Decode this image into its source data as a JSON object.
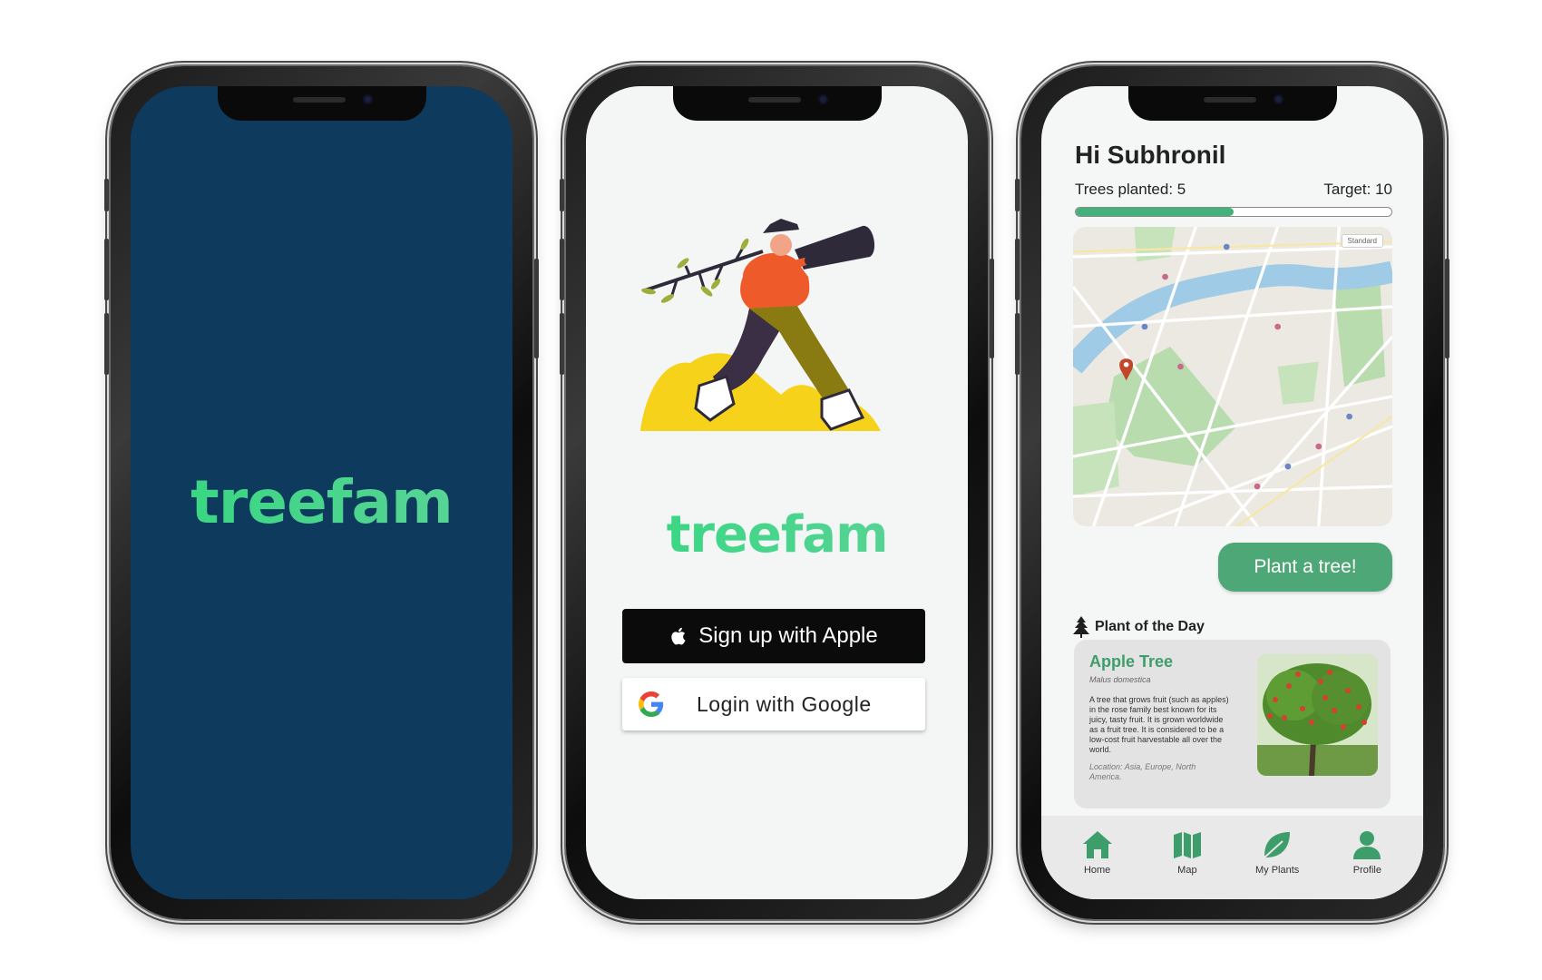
{
  "brand": {
    "logo_text": "treefam",
    "accent": "#3fd98a",
    "primary_dark": "#0e3a5e",
    "green": "#4ea776"
  },
  "splash": {
    "logo": "treefam"
  },
  "login": {
    "logo": "treefam",
    "apple_button": {
      "label": "Sign up with Apple",
      "icon": "apple-icon"
    },
    "google_button": {
      "label": "Login with Google",
      "icon": "google-icon"
    }
  },
  "home": {
    "greeting": "Hi Subhronil",
    "trees_planted": "Trees planted: 5",
    "target": "Target: 10",
    "progress_fraction": 0.5,
    "map_view_select": "Standard",
    "plant_button": "Plant a tree!",
    "plant_of_day": {
      "heading": "Plant of the Day",
      "name": "Apple Tree",
      "scientific_name": "Malus domestica",
      "description": "A tree that grows fruit (such as apples) in the rose family best known for its juicy, tasty fruit. It is grown worldwide as a fruit tree. It is considered to be a low-cost fruit harvestable all over the world.",
      "location": "Location: Asia, Europe, North America."
    },
    "tabs": [
      {
        "label": "Home",
        "icon": "home-icon"
      },
      {
        "label": "Map",
        "icon": "map-icon"
      },
      {
        "label": "My Plants",
        "icon": "leaf-icon"
      },
      {
        "label": "Profile",
        "icon": "profile-icon"
      }
    ]
  }
}
